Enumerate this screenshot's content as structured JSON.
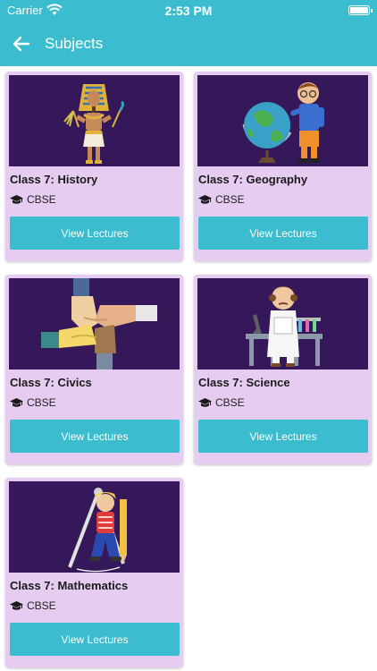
{
  "status_bar": {
    "carrier": "Carrier",
    "time": "2:53 PM"
  },
  "app_bar": {
    "title": "Subjects"
  },
  "subjects": [
    {
      "title": "Class 7: History",
      "board": "CBSE",
      "button_label": "View Lectures",
      "illustration": "pharaoh"
    },
    {
      "title": "Class 7: Geography",
      "board": "CBSE",
      "button_label": "View Lectures",
      "illustration": "boy-with-globe"
    },
    {
      "title": "Class 7: Civics",
      "board": "CBSE",
      "button_label": "View Lectures",
      "illustration": "joined-hands"
    },
    {
      "title": "Class 7: Science",
      "board": "CBSE",
      "button_label": "View Lectures",
      "illustration": "scientist"
    },
    {
      "title": "Class 7: Mathematics",
      "board": "CBSE",
      "button_label": "View Lectures",
      "illustration": "kid-with-compass"
    }
  ],
  "colors": {
    "primary": "#3bbccf",
    "card_background": "#e6ccf0",
    "image_background": "#34185a"
  }
}
